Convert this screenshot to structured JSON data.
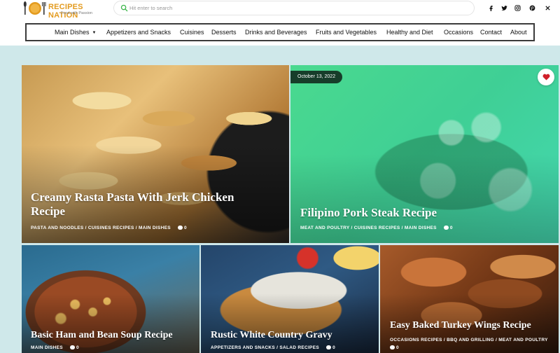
{
  "brand": {
    "title": "RECIPES NATION",
    "tagline": "Food with Passion",
    "accent": "#e39b1f"
  },
  "search": {
    "placeholder": "Hit enter to search",
    "icon": "search-icon"
  },
  "social": [
    {
      "name": "facebook-icon"
    },
    {
      "name": "twitter-icon"
    },
    {
      "name": "instagram-icon"
    },
    {
      "name": "pinterest-icon"
    },
    {
      "name": "close-icon"
    }
  ],
  "nav": {
    "items": [
      {
        "label": "Main Dishes"
      },
      {
        "label": "Appetizers and Snacks"
      },
      {
        "label": "Cuisines"
      },
      {
        "label": "Desserts"
      },
      {
        "label": "Drinks and Beverages"
      },
      {
        "label": "Fruits and Vegetables"
      },
      {
        "label": "Healthy and Diet"
      },
      {
        "label": "Occasions"
      },
      {
        "label": "Contact"
      },
      {
        "label": "About"
      }
    ]
  },
  "posts": [
    {
      "title": "Creamy Rasta Pasta With Jerk Chicken Recipe",
      "categories": "PASTA AND NOODLES / CUISINES RECIPES / MAIN DISHES",
      "comments": "0"
    },
    {
      "title": "Filipino Pork Steak Recipe",
      "categories": "MEAT AND POULTRY / CUISINES RECIPES / MAIN DISHES",
      "comments": "0",
      "date": "October 13, 2022"
    },
    {
      "title": "Basic Ham and Bean Soup Recipe",
      "categories": "MAIN DISHES",
      "comments": "0"
    },
    {
      "title": "Rustic White Country Gravy",
      "categories": "APPETIZERS AND SNACKS / SALAD RECIPES",
      "comments": "0"
    },
    {
      "title": "Easy Baked Turkey Wings Recipe",
      "categories": "OCCASIONS RECIPES / BBQ AND GRILLING / MEAT AND POULTRY",
      "comments": "0"
    }
  ],
  "colors": {
    "hero_bg": "#cfe8ea",
    "highlight_overlay": "#3fd98c",
    "date_badge": "#173d2a",
    "heart": "#d0202a"
  }
}
